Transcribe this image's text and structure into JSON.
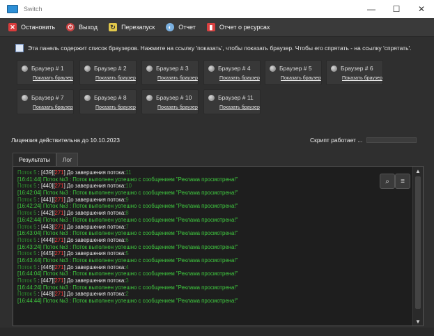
{
  "window": {
    "title": "Switch"
  },
  "toolbar": {
    "stop_label": "Остановить",
    "exit_label": "Выход",
    "restart_label": "Перезапуск",
    "report_label": "Отчет",
    "resources_label": "Отчет о ресурсах"
  },
  "info": {
    "text": "Эта панель содержит список браузеров. Нажмите на ссылку 'показать', чтобы показать браузер. Чтобы его спрятать - на ссылку 'спрятать'."
  },
  "browsers": [
    {
      "name": "Браузер # 1",
      "link": "Показать браузер"
    },
    {
      "name": "Браузер # 2",
      "link": "Показать браузер"
    },
    {
      "name": "Браузер # 3",
      "link": "Показать браузер"
    },
    {
      "name": "Браузер # 4",
      "link": "Показать браузер"
    },
    {
      "name": "Браузер # 5",
      "link": "Показать браузер"
    },
    {
      "name": "Браузер # 6",
      "link": "Показать браузер"
    },
    {
      "name": "Браузер # 7",
      "link": "Показать браузер"
    },
    {
      "name": "Браузер # 8",
      "link": "Показать браузер"
    },
    {
      "name": "Браузер # 10",
      "link": "Показать браузер"
    },
    {
      "name": "Браузер # 11",
      "link": "Показать браузер"
    }
  ],
  "status": {
    "license": "Лицензия действительна до 10.10.2023",
    "script": "Скрипт работает ..."
  },
  "tabs": {
    "results": "Результаты",
    "log": "Лог"
  },
  "log": [
    {
      "time": "Поток 5",
      "prefix": " : [",
      "num": "439",
      "sep": "][",
      "code": "271",
      "suffix": "] До завершения потока:",
      "tail": "11",
      "type": "progress"
    },
    {
      "time": "[16:41:44]",
      "text": " Поток №3 : Поток выполнен успешно с сообщением \"Реклама просмотрена!\"",
      "type": "success"
    },
    {
      "time": "Поток 5",
      "prefix": " : [",
      "num": "440",
      "sep": "][",
      "code": "271",
      "suffix": "] До завершения потока:",
      "tail": "10",
      "type": "progress"
    },
    {
      "time": "[16:42:04]",
      "text": " Поток №3 : Поток выполнен успешно с сообщением \"Реклама просмотрена!\"",
      "type": "success"
    },
    {
      "time": "Поток 5",
      "prefix": " : [",
      "num": "441",
      "sep": "][",
      "code": "271",
      "suffix": "] До завершения потока:",
      "tail": "9",
      "type": "progress"
    },
    {
      "time": "[16:42:24]",
      "text": " Поток №3 : Поток выполнен успешно с сообщением \"Реклама просмотрена!\"",
      "type": "success"
    },
    {
      "time": "Поток 5",
      "prefix": " : [",
      "num": "442",
      "sep": "][",
      "code": "271",
      "suffix": "] До завершения потока:",
      "tail": "8",
      "type": "progress"
    },
    {
      "time": "[16:42:44]",
      "text": " Поток №3 : Поток выполнен успешно с сообщением \"Реклама просмотрена!\"",
      "type": "success"
    },
    {
      "time": "Поток 5",
      "prefix": " : [",
      "num": "443",
      "sep": "][",
      "code": "271",
      "suffix": "] До завершения потока:",
      "tail": "7",
      "type": "progress"
    },
    {
      "time": "[16:43:04]",
      "text": " Поток №3 : Поток выполнен успешно с сообщением \"Реклама просмотрена!\"",
      "type": "success"
    },
    {
      "time": "Поток 5",
      "prefix": " : [",
      "num": "444",
      "sep": "][",
      "code": "271",
      "suffix": "] До завершения потока:",
      "tail": "6",
      "type": "progress"
    },
    {
      "time": "[16:43:24]",
      "text": " Поток №3 : Поток выполнен успешно с сообщением \"Реклама просмотрена!\"",
      "type": "success"
    },
    {
      "time": "Поток 5",
      "prefix": " : [",
      "num": "445",
      "sep": "][",
      "code": "271",
      "suffix": "] До завершения потока:",
      "tail": "5",
      "type": "progress"
    },
    {
      "time": "[16:43:44]",
      "text": " Поток №3 : Поток выполнен успешно с сообщением \"Реклама просмотрена!\"",
      "type": "success"
    },
    {
      "time": "Поток 5",
      "prefix": " : [",
      "num": "446",
      "sep": "][",
      "code": "271",
      "suffix": "] До завершения потока:",
      "tail": "4",
      "type": "progress"
    },
    {
      "time": "[16:44:04]",
      "text": " Поток №3 : Поток выполнен успешно с сообщением \"Реклама просмотрена!\"",
      "type": "success"
    },
    {
      "time": "Поток 5",
      "prefix": " : [",
      "num": "447",
      "sep": "][",
      "code": "271",
      "suffix": "] До завершения потока:",
      "tail": "3",
      "type": "progress"
    },
    {
      "time": "[16:44:24]",
      "text": " Поток №3 : Поток выполнен успешно с сообщением \"Реклама просмотрена!\"",
      "type": "success"
    },
    {
      "time": "Поток 5",
      "prefix": " : [",
      "num": "448",
      "sep": "][",
      "code": "271",
      "suffix": "] До завершения потока:",
      "tail": "2",
      "type": "progress"
    },
    {
      "time": "[16:44:44]",
      "text": " Поток №3 : Поток выполнен успешно с сообщением \"Реклама просмотрена!\"",
      "type": "success"
    }
  ],
  "colors": {
    "success": "#3fc93f",
    "highlight": "#ff3b3b",
    "background": "#2f2f2f"
  }
}
